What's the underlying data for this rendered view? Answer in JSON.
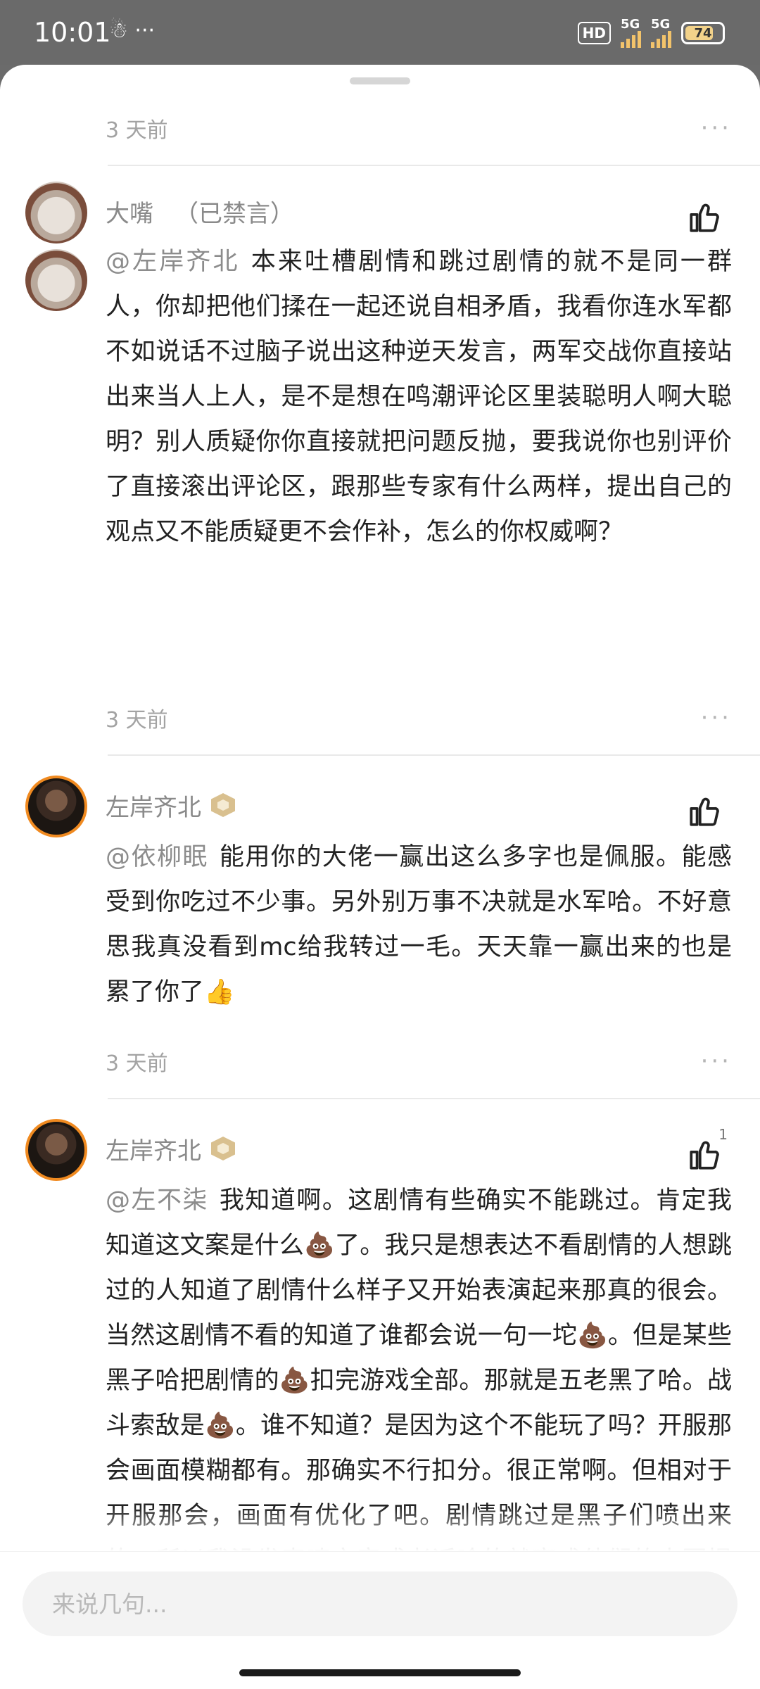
{
  "status_bar": {
    "time": "10:01",
    "left_icons": "☃ ···",
    "hd": "HD",
    "net1": "5G",
    "net2": "5G",
    "battery": "74"
  },
  "comments": [
    {
      "time": "3 天前",
      "more": "···"
    },
    {
      "username": "大嘴",
      "status": "（已禁言）",
      "mention": "@左岸齐北",
      "text": "本来吐槽剧情和跳过剧情的就不是同一群人，你却把他们揉在一起还说自相矛盾，我看你连水军都不如说话不过脑子说出这种逆天发言，两军交战你直接站出来当人上人，是不是想在鸣潮评论区里装聪明人啊大聪明？别人质疑你你直接就把问题反抛，要我说你也别评价了直接滚出评论区，跟那些专家有什么两样，提出自己的观点又不能质疑更不会作补，怎么的你权威啊？",
      "time": "3 天前",
      "more": "···"
    },
    {
      "username": "左岸齐北",
      "mention": "@依柳眠",
      "text": "能用你的大佬一赢出这么多字也是佩服。能感受到你吃过不少事。另外别万事不决就是水军哈。不好意思我真没看到mc给我转过一毛。天天靠一赢出来的也是累了你了👍",
      "time": "3 天前",
      "more": "···"
    },
    {
      "username": "左岸齐北",
      "mention": "@左不柒",
      "text": "我知道啊。这剧情有些确实不能跳过。肯定我知道这文案是什么💩了。我只是想表达不看剧情的人想跳过的人知道了剧情什么样子又开始表演起来那真的很会。当然这剧情不看的知道了谁都会说一句一坨💩。但是某些黑子哈把剧情的💩扣完游戏全部。那就是五老黑了哈。战斗索敌是💩。谁不知道？是因为这个不能玩了吗？开服那会画面模糊都有。那确实不行扣分。很正常啊。但相对于开服那会，画面有优化了吧。剧情跳过是黑子们喷出来的。所以我没发表喷文章或者话啥的就变成他们的水军提纯了。网友真的很会一赢",
      "like_count": "1"
    }
  ],
  "input": {
    "placeholder": "来说几句..."
  }
}
